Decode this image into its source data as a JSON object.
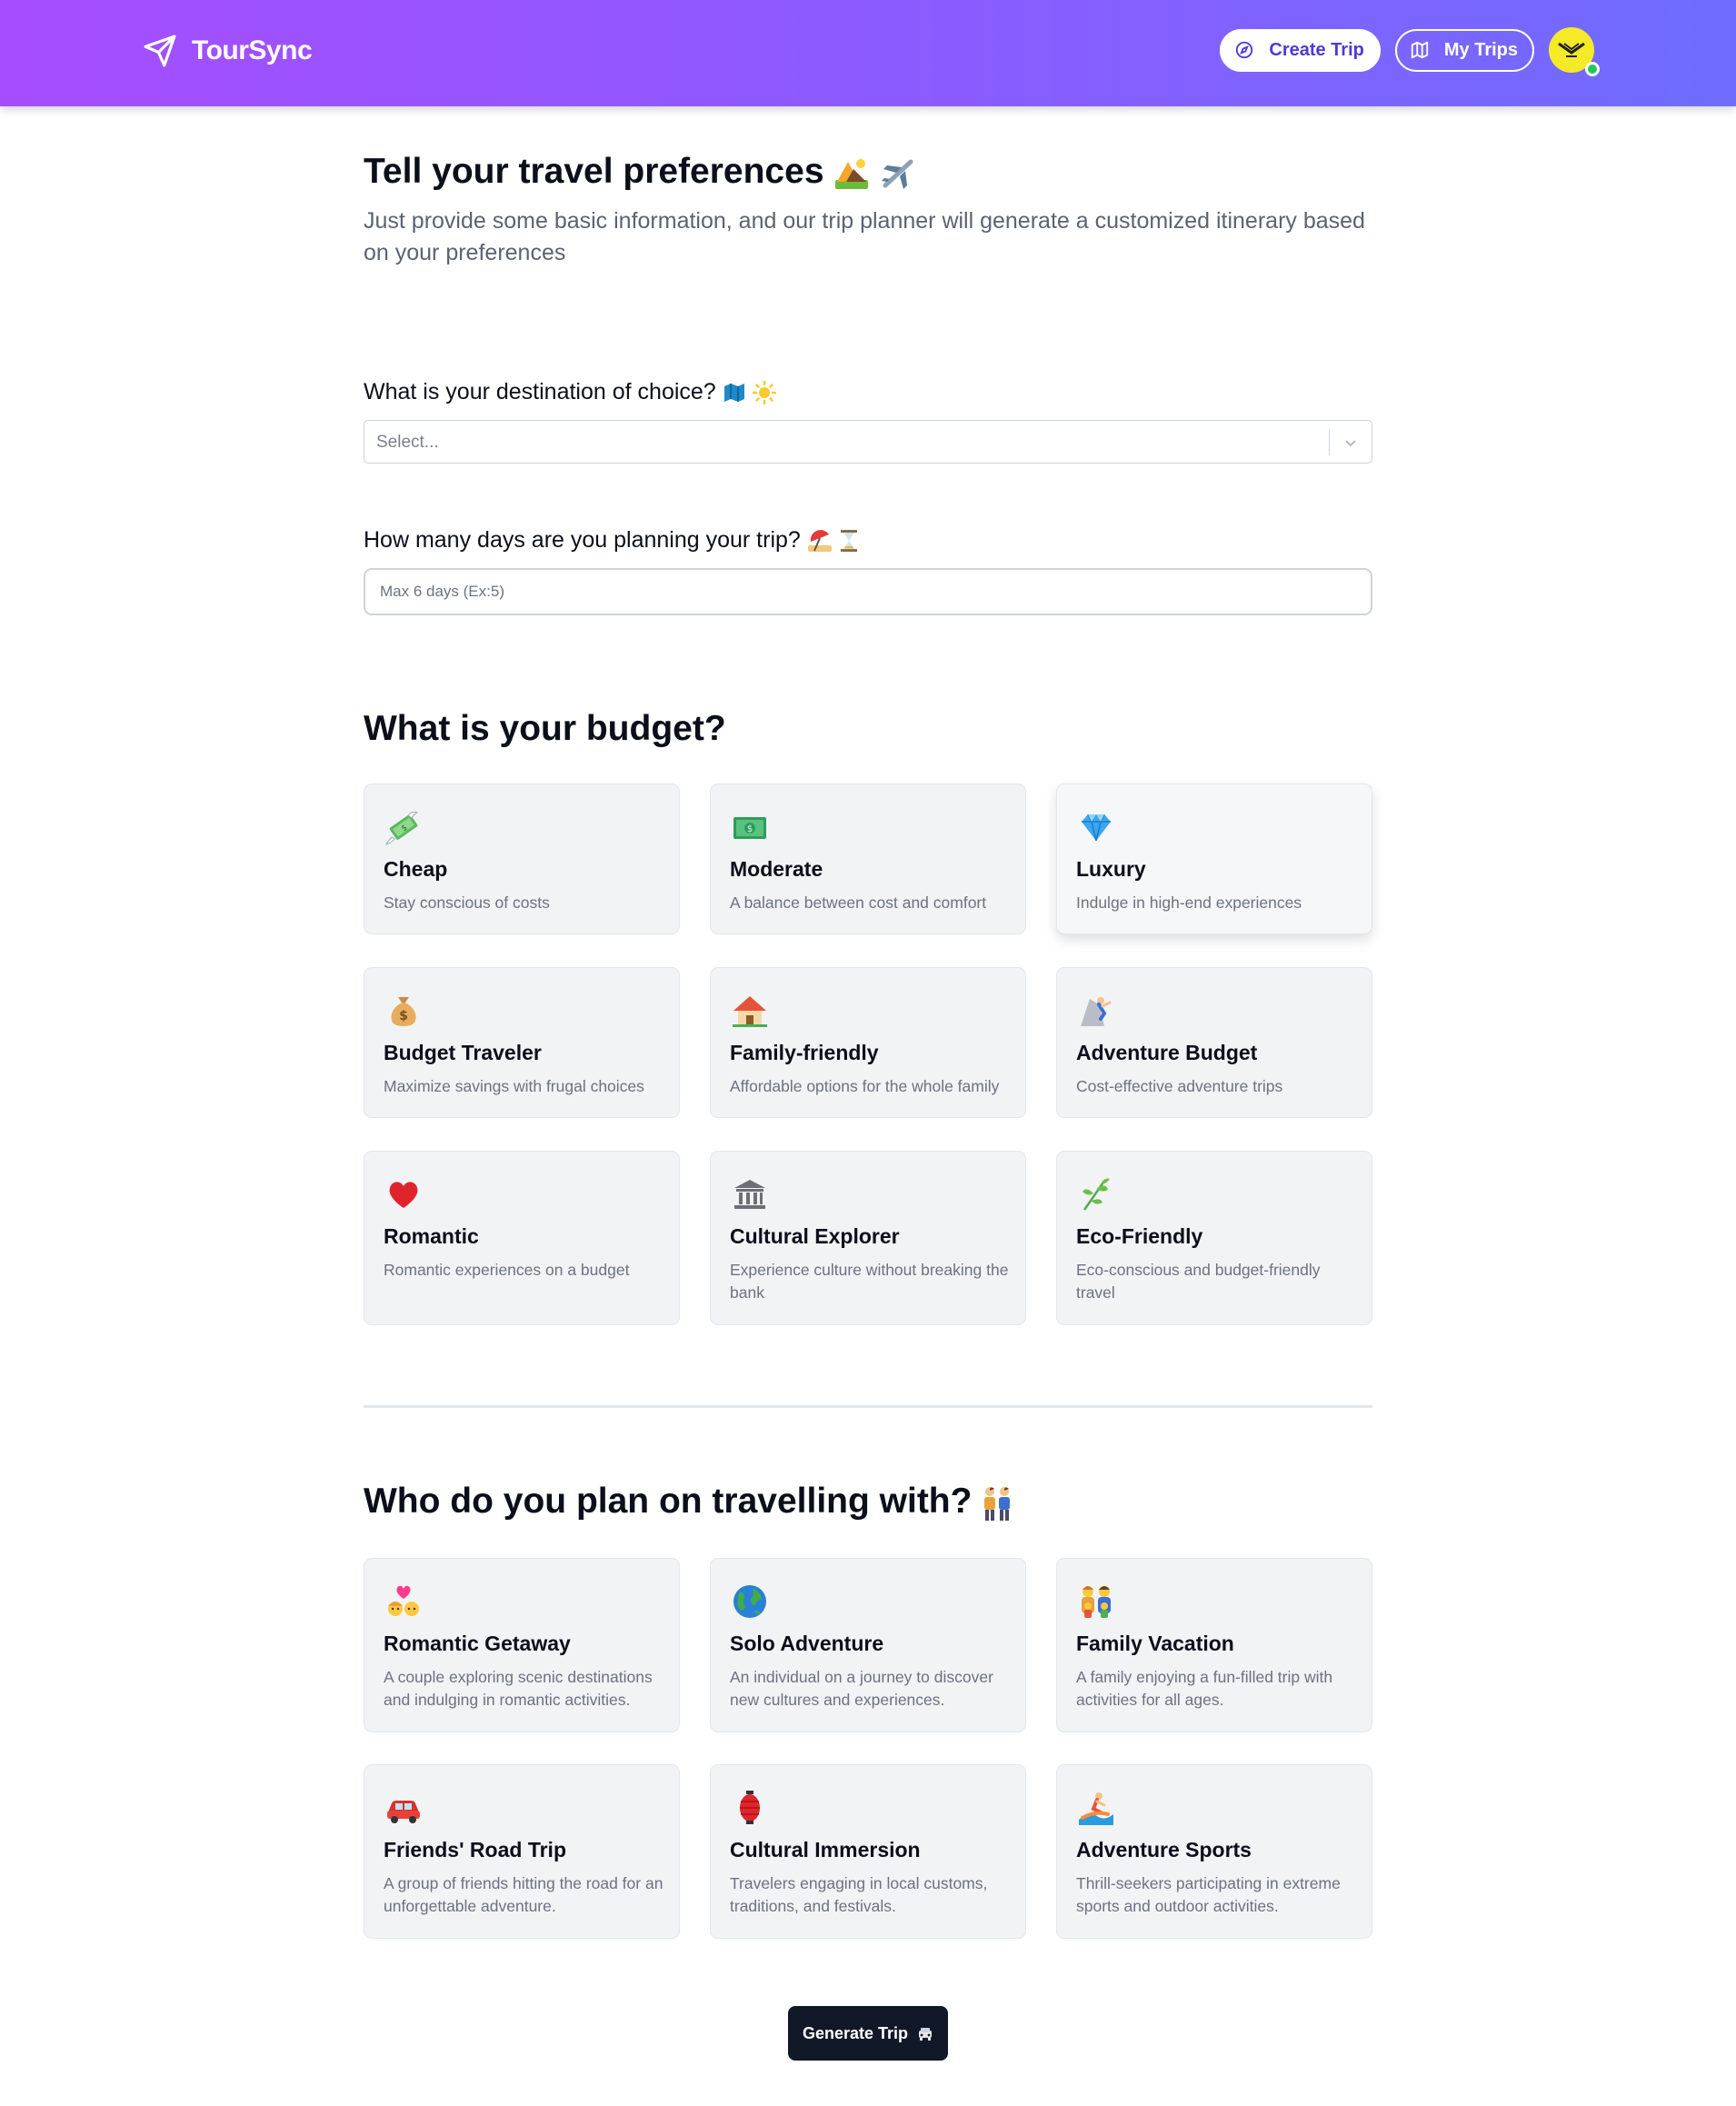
{
  "header": {
    "brand": "TourSync",
    "create_trip": "Create Trip",
    "my_trips": "My Trips"
  },
  "intro": {
    "title": "Tell your travel preferences",
    "subtitle": "Just provide some basic information, and our trip planner will generate a customized itinerary based on your preferences"
  },
  "destination": {
    "label": "What is your destination of choice?",
    "placeholder": "Select..."
  },
  "days": {
    "label": "How many days are you planning your trip?",
    "placeholder": "Max 6 days (Ex:5)"
  },
  "budget": {
    "title": "What is your budget?",
    "options": [
      {
        "title": "Cheap",
        "desc": "Stay conscious of costs",
        "icon": "money-with-wings-icon"
      },
      {
        "title": "Moderate",
        "desc": "A balance between cost and comfort",
        "icon": "banknote-icon"
      },
      {
        "title": "Luxury",
        "desc": "Indulge in high-end experiences",
        "icon": "gem-icon"
      },
      {
        "title": "Budget Traveler",
        "desc": "Maximize savings with frugal choices",
        "icon": "money-bag-icon"
      },
      {
        "title": "Family-friendly",
        "desc": "Affordable options for the whole family",
        "icon": "house-icon"
      },
      {
        "title": "Adventure Budget",
        "desc": "Cost-effective adventure trips",
        "icon": "climber-icon"
      },
      {
        "title": "Romantic",
        "desc": "Romantic experiences on a budget",
        "icon": "heart-icon"
      },
      {
        "title": "Cultural Explorer",
        "desc": "Experience culture without breaking the bank",
        "icon": "classical-building-icon"
      },
      {
        "title": "Eco-Friendly",
        "desc": "Eco-conscious and budget-friendly travel",
        "icon": "herb-icon"
      }
    ]
  },
  "companions": {
    "title": "Who do you plan on travelling with?",
    "options": [
      {
        "title": "Romantic Getaway",
        "desc": "A couple exploring scenic destinations and indulging in romantic activities.",
        "icon": "couple-with-heart-icon"
      },
      {
        "title": "Solo Adventure",
        "desc": "An individual on a journey to discover new cultures and experiences.",
        "icon": "globe-icon"
      },
      {
        "title": "Family Vacation",
        "desc": "A family enjoying a fun-filled trip with activities for all ages.",
        "icon": "family-icon"
      },
      {
        "title": "Friends' Road Trip",
        "desc": "A group of friends hitting the road for an unforgettable adventure.",
        "icon": "car-icon"
      },
      {
        "title": "Cultural Immersion",
        "desc": "Travelers engaging in local customs, traditions, and festivals.",
        "icon": "lantern-icon"
      },
      {
        "title": "Adventure Sports",
        "desc": "Thrill-seekers participating in extreme sports and outdoor activities.",
        "icon": "surfer-icon"
      }
    ]
  },
  "actions": {
    "generate": "Generate Trip"
  },
  "colors": {
    "header_gradient_start": "#a64dff",
    "header_gradient_end": "#6f6cff",
    "primary_button_text": "#4c3bd6",
    "card_bg": "#f2f3f5",
    "generate_bg": "#111827"
  }
}
